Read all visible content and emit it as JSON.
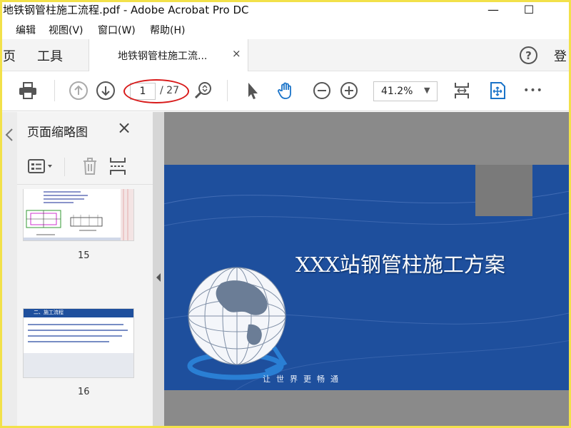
{
  "window": {
    "title": "地铁钢管柱施工流程.pdf - Adobe Acrobat Pro DC",
    "minimize_label": "—",
    "maximize_label": "☐"
  },
  "menu": [
    "编辑",
    "视图(V)",
    "窗口(W)",
    "帮助(H)"
  ],
  "tabs": {
    "home_label": "页",
    "tools_label": "工具",
    "document_label": "地铁钢管柱施工流...",
    "close_label": "×",
    "help_label": "?",
    "login_label": "登"
  },
  "toolbar": {
    "current_page": "1",
    "total_pages": "/ 27",
    "zoom": "41.2%",
    "more_label": "•••"
  },
  "sidebar": {
    "title": "页面缩略图",
    "close_label": "×",
    "thumbnails": [
      {
        "page_number": "15"
      },
      {
        "page_number": "16",
        "heading": "二、施工流程"
      }
    ]
  },
  "slide": {
    "title": "XXX站钢管柱施工方案",
    "subtitle": "让世界更畅通"
  },
  "colors": {
    "slide_blue": "#1e4f9d",
    "annotation_red": "#d81a1a",
    "icon_blue": "#1a73c8"
  }
}
